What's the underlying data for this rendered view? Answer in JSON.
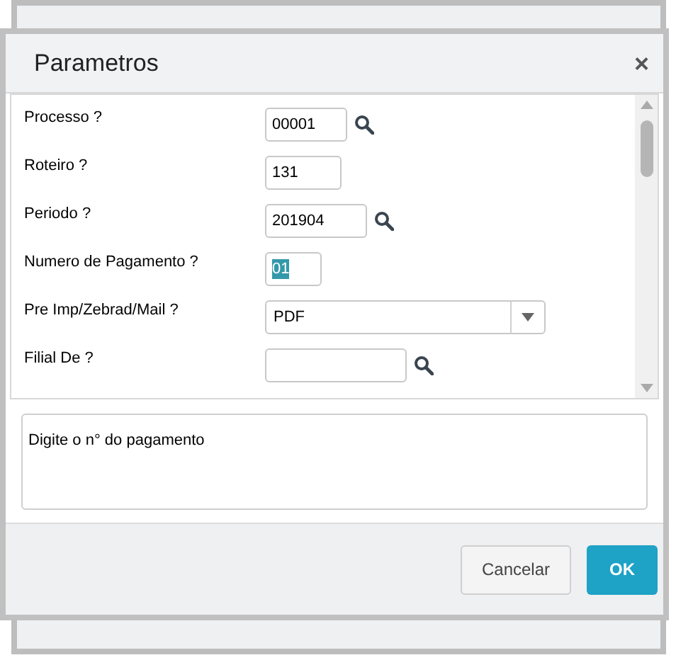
{
  "dialog": {
    "title": "Parametros",
    "close": "×"
  },
  "params": [
    {
      "label": "Processo ?",
      "kind": "lookup",
      "value": "00001",
      "highlighted": false
    },
    {
      "label": "Roteiro ?",
      "kind": "text",
      "value": "131",
      "highlighted": false
    },
    {
      "label": "Periodo ?",
      "kind": "lookup",
      "value": "201904",
      "highlighted": false
    },
    {
      "label": "Numero de Pagamento ?",
      "kind": "text",
      "value": "01",
      "highlighted": true
    },
    {
      "label": "Pre Imp/Zebrad/Mail ?",
      "kind": "select",
      "value": "PDF",
      "highlighted": false
    },
    {
      "label": "Filial De ?",
      "kind": "lookup",
      "highlighted": false
    }
  ],
  "help": "Digite o n° do pagamento",
  "buttons": [
    {
      "label": "Cancelar",
      "kind": "secondary"
    },
    {
      "label": "OK",
      "kind": "primary"
    }
  ]
}
